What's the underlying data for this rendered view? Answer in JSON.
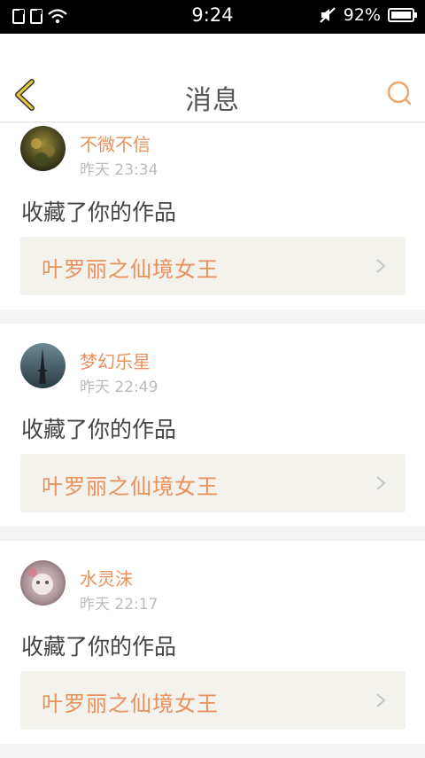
{
  "status_bar": {
    "time": "9:24",
    "battery": "92%",
    "icons": [
      "sim-card-icon",
      "sim-card-icon",
      "wifi-icon",
      "mute-icon",
      "battery-icon"
    ]
  },
  "header": {
    "title": "消息",
    "back_icon": "chevron-left-icon",
    "search_icon": "search-icon"
  },
  "messages": [
    {
      "username": "不微不信",
      "time": "昨天 23:34",
      "action": "收藏了你的作品",
      "work_title": "叶罗丽之仙境女王"
    },
    {
      "username": "梦幻乐星",
      "time": "昨天 22:49",
      "action": "收藏了你的作品",
      "work_title": "叶罗丽之仙境女王"
    },
    {
      "username": "水灵沫",
      "time": "昨天 22:17",
      "action": "收藏了你的作品",
      "work_title": "叶罗丽之仙境女王"
    }
  ],
  "colors": {
    "accent": "#e8915d",
    "back_icon": "#d9bd2e",
    "card_bg": "#f3f2ec"
  }
}
